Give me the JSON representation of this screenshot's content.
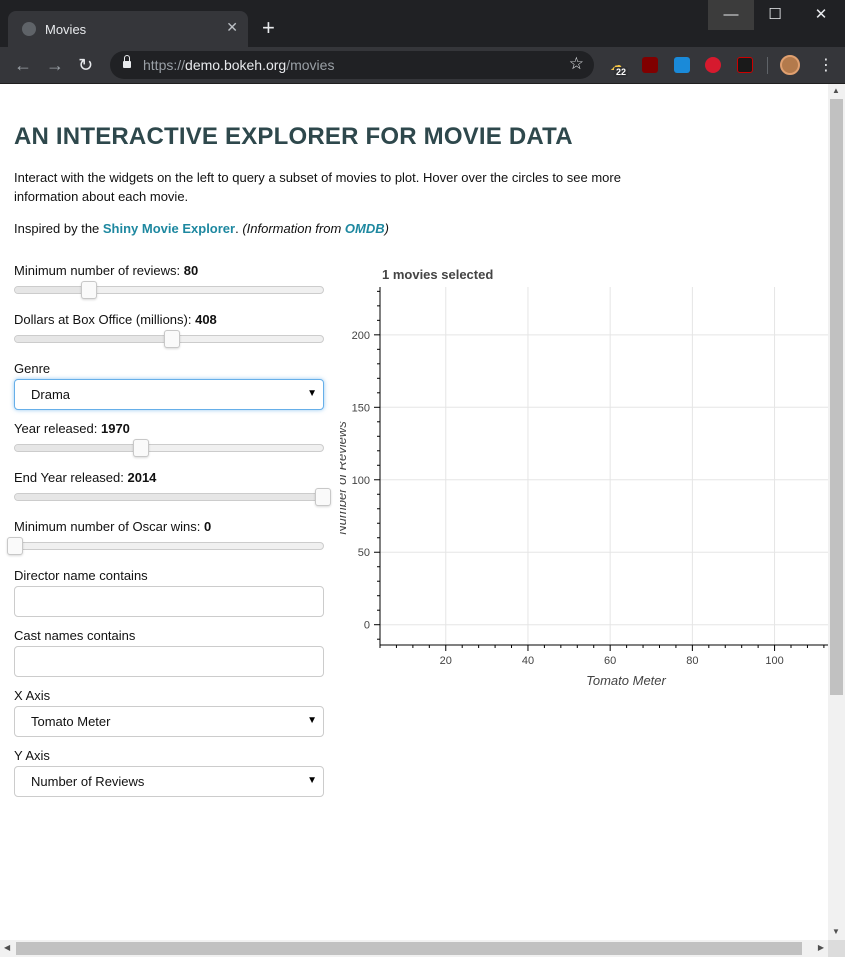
{
  "browser": {
    "tab_title": "Movies",
    "tab_close": "✕",
    "new_tab": "+",
    "url_scheme": "https://",
    "url_host": "demo.bokeh.org",
    "url_path": "/movies",
    "weather_badge": "22",
    "window": {
      "minimize": "—",
      "maximize": "☐",
      "close": "✕"
    }
  },
  "page": {
    "title": "AN INTERACTIVE EXPLORER FOR MOVIE DATA",
    "intro": "Interact with the widgets on the left to query a subset of movies to plot. Hover over the circles to see more information about each movie.",
    "inspired_prefix": "Inspired by the ",
    "shiny_link": "Shiny Movie Explorer",
    "inspired_mid": ". ",
    "info_prefix": "(Information from ",
    "omdb_link": "OMDB",
    "info_suffix": ")"
  },
  "controls": {
    "min_reviews": {
      "label": "Minimum number of reviews: ",
      "value": "80",
      "fraction": 0.24
    },
    "box_office": {
      "label": "Dollars at Box Office (millions): ",
      "value": "408",
      "fraction": 0.51
    },
    "genre": {
      "label": "Genre",
      "selected": "Drama"
    },
    "year_start": {
      "label": "Year released: ",
      "value": "1970",
      "fraction": 0.41
    },
    "year_end": {
      "label": "End Year released: ",
      "value": "2014",
      "fraction": 1.0
    },
    "oscar_wins": {
      "label": "Minimum number of Oscar wins: ",
      "value": "0",
      "fraction": 0.0
    },
    "director": {
      "label": "Director name contains",
      "value": ""
    },
    "cast": {
      "label": "Cast names contains",
      "value": ""
    },
    "x_axis": {
      "label": "X Axis",
      "selected": "Tomato Meter"
    },
    "y_axis": {
      "label": "Y Axis",
      "selected": "Number of Reviews"
    }
  },
  "chart_data": {
    "type": "scatter",
    "title": "1 movies selected",
    "xlabel": "Tomato Meter",
    "ylabel": "Number of Reviews",
    "xlim": [
      4,
      113
    ],
    "ylim": [
      -14,
      233
    ],
    "x_ticks": [
      20,
      40,
      60,
      80,
      100
    ],
    "y_ticks": [
      0,
      50,
      100,
      150,
      200
    ],
    "grid": true,
    "points": [],
    "colors": {
      "axis": "#000000",
      "grid": "#e5e5e5",
      "tick_label": "#444444",
      "axis_label": "#444444"
    }
  },
  "colors": {
    "title": "#2e484c",
    "link": "#1e88a0",
    "focus": "#66afe9"
  }
}
